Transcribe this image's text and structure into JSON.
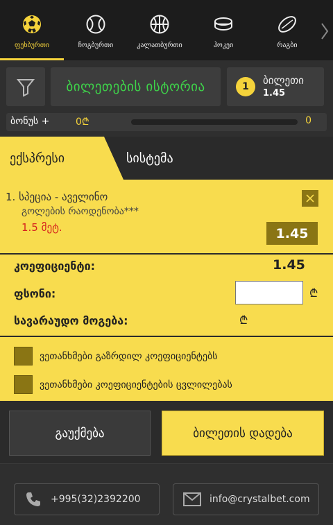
{
  "sport_nav": {
    "items": [
      {
        "label": "ფეხბურთი",
        "icon": "soccer-ball-icon",
        "active": true
      },
      {
        "label": "ჩოგბურთი",
        "icon": "tennis-ball-icon",
        "active": false
      },
      {
        "label": "კალათბურთი",
        "icon": "basketball-icon",
        "active": false
      },
      {
        "label": "ჰოკეი",
        "icon": "hockey-puck-icon",
        "active": false
      },
      {
        "label": "რაგბი",
        "icon": "rugby-ball-icon",
        "active": false
      }
    ],
    "next_icon": "chevron-right-icon"
  },
  "toolbar": {
    "filter_icon": "funnel-icon",
    "history_label": "ბილეთების ისტორია",
    "tickets_count": "1",
    "tickets_label": "ბილეთი",
    "tickets_odds": "1.45"
  },
  "bonus": {
    "label": "ბონუს +",
    "amount": "0₾",
    "count": "0"
  },
  "tabs": {
    "express": "ექსპრესი",
    "system": "სისტემა"
  },
  "selection": {
    "match": "1. სპეცია - აველინო",
    "market": "გოლების რაოდენობა***",
    "pick": "1.5 მეტ.",
    "odds": "1.45",
    "close_icon": "close-icon"
  },
  "bet_form": {
    "coef_label": "კოეფიციენტი:",
    "coef_value": "1.45",
    "stake_label": "ფსონი:",
    "stake_value": "",
    "currency": "₾",
    "win_label": "სავარაუდო მოგება:"
  },
  "agreements": {
    "increased_odds": "ვეთანხმები გაზრდილ კოეფიციენტებს",
    "odds_change": "ვეთანხმები კოეფიციენტების ცვლილებას"
  },
  "actions": {
    "cancel": "გაუქმება",
    "place": "ბილეთის დადება"
  },
  "footer": {
    "phone": "+995(32)2392200",
    "email": "info@crystalbet.com"
  },
  "colors": {
    "accent": "#f8dc4e",
    "dark_accent": "#8a7514",
    "green": "#3ed34a",
    "red": "#d6241e"
  }
}
